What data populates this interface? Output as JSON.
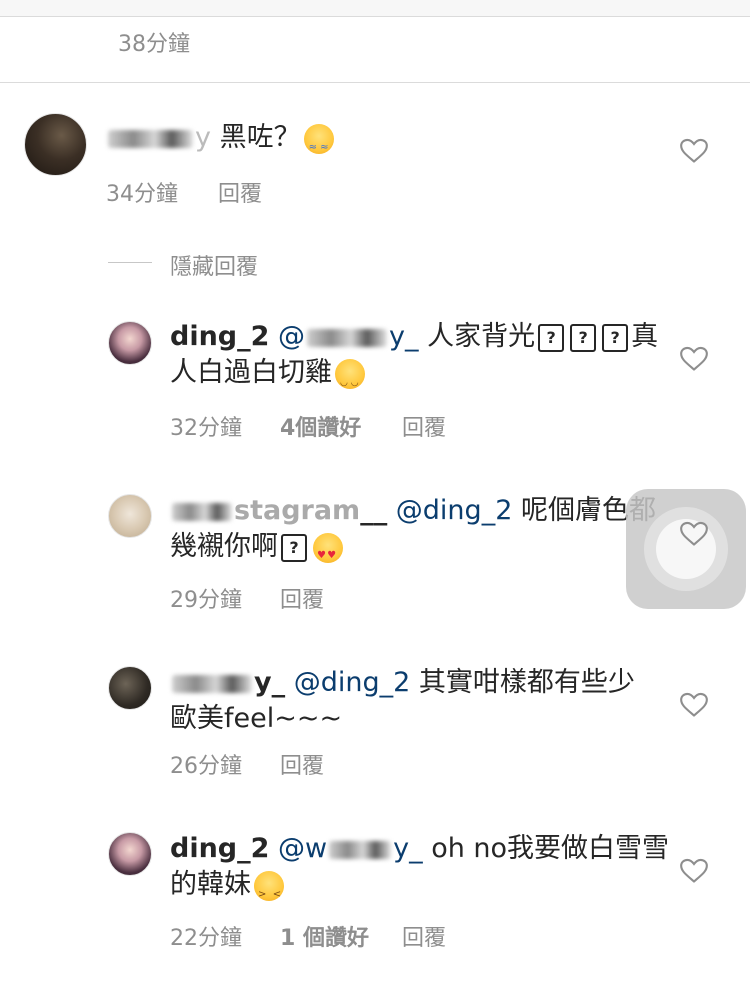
{
  "top": {
    "time": "38分鐘"
  },
  "comment": {
    "username_suffix": "y",
    "text": "黑咗？",
    "time": "34分鐘",
    "reply": "回覆"
  },
  "hidden_replies": "隱藏回覆",
  "replies": [
    {
      "username": "ding_2",
      "mention_prefix": "@",
      "mention_suffix": "y_",
      "line1": "人家背光",
      "line1_end": "真",
      "line2": "人白過白切雞",
      "time": "32分鐘",
      "likes": "4個讚好",
      "reply": "回覆"
    },
    {
      "username_visible": "stagram",
      "username_suffix": "__",
      "mention": "@ding_2",
      "line1": "呢個膚色都",
      "line2": "幾襯你啊",
      "time": "29分鐘",
      "reply": "回覆"
    },
    {
      "username_suffix": "y_",
      "mention": "@ding_2",
      "line1": "其實咁樣都有些少",
      "line2": "歐美feel~~~",
      "time": "26分鐘",
      "reply": "回覆"
    },
    {
      "username": "ding_2",
      "mention_prefix": "@w",
      "mention_suffix": "y_",
      "line1": "oh no我要做白雪雪",
      "line2": "的韓妹",
      "time": "22分鐘",
      "likes": "1 個讚好",
      "reply": "回覆"
    }
  ],
  "box_glyph": "?",
  "icons": {
    "like": "heart-outline-icon",
    "assistive": "assistive-touch-icon"
  },
  "colors": {
    "text": "#262626",
    "secondary": "#8e8e8e",
    "mention": "#0b3d6e"
  }
}
